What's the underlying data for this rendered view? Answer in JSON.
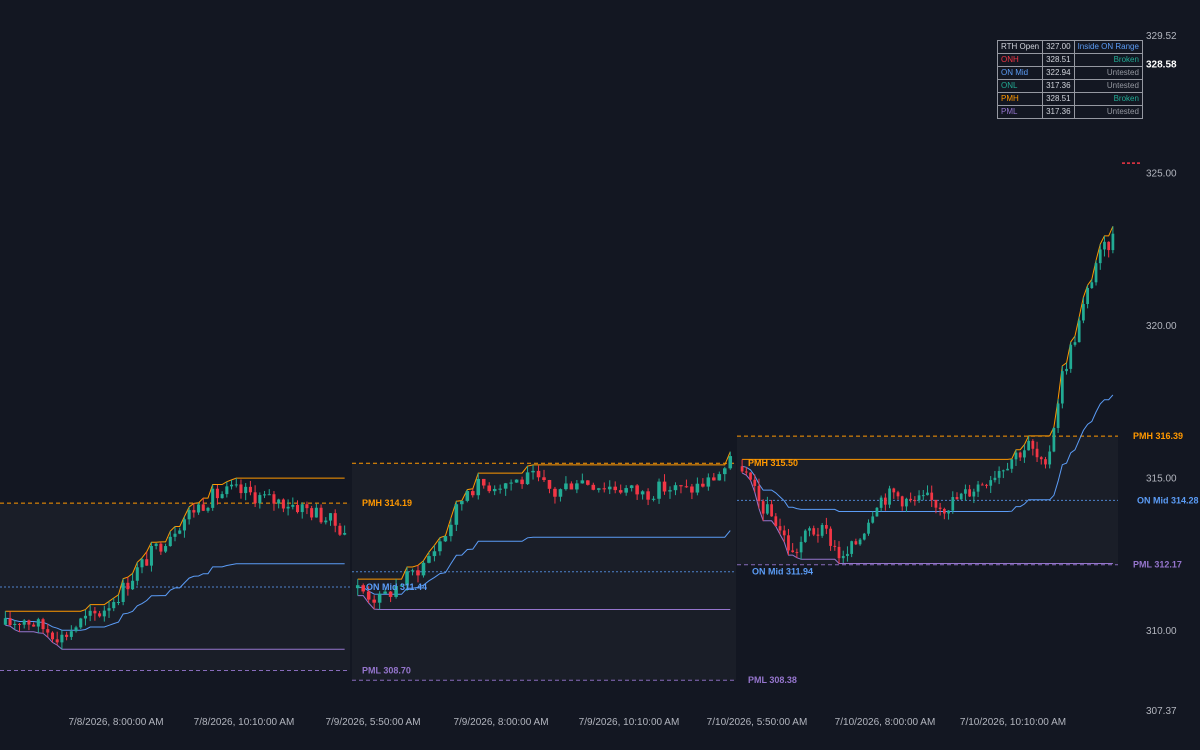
{
  "status_table": {
    "rows": [
      {
        "label": "RTH Open",
        "value": "327.00",
        "status": "Inside ON Range",
        "label_color": "#d1d4dc",
        "status_color": "#5b9cf6"
      },
      {
        "label": "ONH",
        "value": "328.51",
        "status": "Broken",
        "label_color": "#f23645",
        "status_color": "#22ab94"
      },
      {
        "label": "ON Mid",
        "value": "322.94",
        "status": "Untested",
        "label_color": "#5b9cf6",
        "status_color": "#9598a1"
      },
      {
        "label": "ONL",
        "value": "317.36",
        "status": "Untested",
        "label_color": "#22ab94",
        "status_color": "#9598a1"
      },
      {
        "label": "PMH",
        "value": "328.51",
        "status": "Broken",
        "label_color": "#ff9800",
        "status_color": "#22ab94"
      },
      {
        "label": "PML",
        "value": "317.36",
        "status": "Untested",
        "label_color": "#9575cd",
        "status_color": "#9598a1"
      }
    ]
  },
  "chart_data": {
    "type": "candlestick",
    "x_tick_labels": [
      "7/8/2026, 8:00:00 AM",
      "7/8/2026, 10:10:00 AM",
      "7/9/2026, 5:50:00 AM",
      "7/9/2026, 8:00:00 AM",
      "7/9/2026, 10:10:00 AM",
      "7/10/2026, 5:50:00 AM",
      "7/10/2026, 8:00:00 AM",
      "7/10/2026, 10:10:00 AM"
    ],
    "y_tick_labels": [
      "329.52",
      "325.00",
      "320.00",
      "315.00",
      "310.00",
      "307.37"
    ],
    "y_ticks": [
      329.52,
      325.0,
      320.0,
      315.0,
      310.0,
      307.37
    ],
    "ylim": [
      307.37,
      329.52
    ],
    "last_price_label": "328.58",
    "last_price": 328.58,
    "colors": {
      "up": "#22ab94",
      "down": "#f23645",
      "pmh": "#ff9800",
      "pml": "#9575cd",
      "on_mid": "#5b9cf6",
      "onh_marker": "#f23645"
    },
    "level_labels": [
      {
        "name": "PMH",
        "value": 314.19,
        "text": "PMH  314.19",
        "series": "pmh"
      },
      {
        "name": "ON Mid",
        "value": 311.44,
        "text": "ON Mid  311.44",
        "series": "on_mid"
      },
      {
        "name": "PML",
        "value": 308.7,
        "text": "PML  308.70",
        "series": "pml"
      },
      {
        "name": "PMH",
        "value": 315.5,
        "text": "PMH  315.50",
        "series": "pmh"
      },
      {
        "name": "ON Mid",
        "value": 311.94,
        "text": "ON Mid  311.94",
        "series": "on_mid"
      },
      {
        "name": "PML",
        "value": 308.38,
        "text": "PML  308.38",
        "series": "pml"
      },
      {
        "name": "PMH",
        "value": 316.39,
        "text": "PMH  316.39",
        "series": "pmh"
      },
      {
        "name": "ON Mid",
        "value": 314.28,
        "text": "ON Mid  314.28",
        "series": "on_mid"
      },
      {
        "name": "PML",
        "value": 312.17,
        "text": "PML  312.17",
        "series": "pml"
      }
    ],
    "ohlc_anchor_closes": {
      "day1": [
        310.2,
        310.4,
        310.1,
        309.8,
        310.3,
        310.6,
        311.2,
        312.0,
        312.7,
        313.4,
        314.0,
        314.4,
        314.6,
        314.5,
        314.3,
        314.2,
        314.0,
        313.7,
        313.3
      ],
      "day2": [
        311.4,
        311.0,
        311.6,
        312.2,
        313.2,
        314.7,
        314.8,
        314.9,
        315.0,
        314.5,
        315.0,
        314.8,
        314.7,
        314.5,
        314.7,
        314.6,
        314.9,
        315.5
      ],
      "day3": [
        315.4,
        314.2,
        313.6,
        312.5,
        313.3,
        313.2,
        312.3,
        313.1,
        314.3,
        314.5,
        314.2,
        314.3,
        314.1,
        314.4,
        314.8,
        315.2,
        315.7,
        316.1,
        315.2,
        318.4,
        320.1,
        322.1,
        322.9
      ]
    }
  }
}
